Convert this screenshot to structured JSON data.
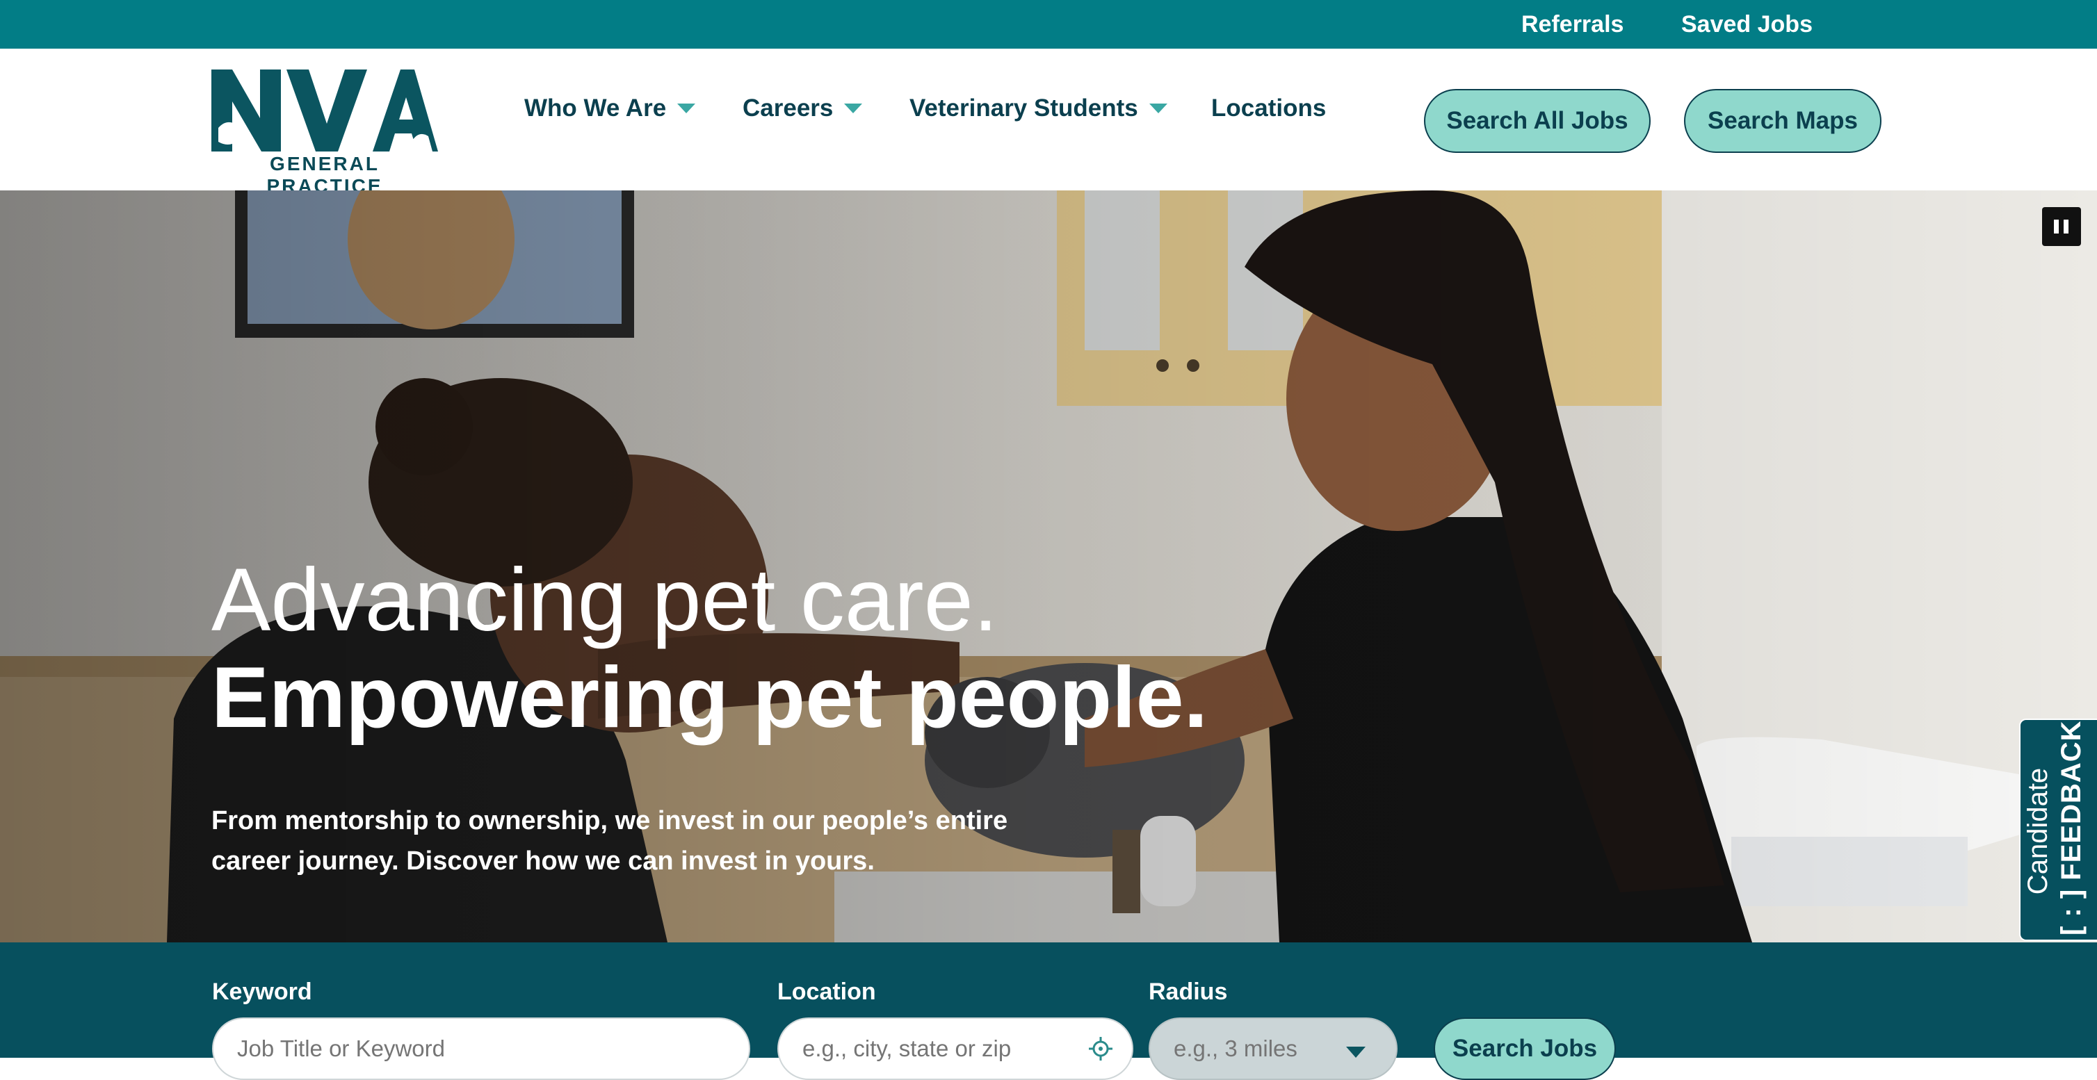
{
  "utility": {
    "referrals": "Referrals",
    "saved_jobs": "Saved Jobs"
  },
  "brand": {
    "logo_text": "NVA",
    "logo_subtitle": "GENERAL PRACTICE",
    "colors": {
      "primary_teal": "#027d86",
      "dark_teal": "#07505e",
      "navy_text": "#0b3f4e",
      "mint_button": "#8fd8cc"
    }
  },
  "nav": {
    "items": [
      {
        "label": "Who We Are",
        "has_dropdown": true
      },
      {
        "label": "Careers",
        "has_dropdown": true
      },
      {
        "label": "Veterinary Students",
        "has_dropdown": true
      },
      {
        "label": "Locations",
        "has_dropdown": false
      }
    ],
    "search_all_jobs": "Search All Jobs",
    "search_maps": "Search Maps"
  },
  "hero": {
    "headline_light": "Advancing pet care.",
    "headline_bold": "Empowering pet people.",
    "subtext": "From mentorship to ownership, we invest in our people’s entire career journey. Discover how we can invest in yours.",
    "pause_icon": "pause-icon"
  },
  "feedback": {
    "line1": "Candidate",
    "line2": "FEEDBACK"
  },
  "search": {
    "keyword_label": "Keyword",
    "keyword_placeholder": "Job Title or Keyword",
    "location_label": "Location",
    "location_placeholder": "e.g., city, state or zip",
    "radius_label": "Radius",
    "radius_placeholder": "e.g., 3 miles",
    "submit_label": "Search Jobs"
  }
}
